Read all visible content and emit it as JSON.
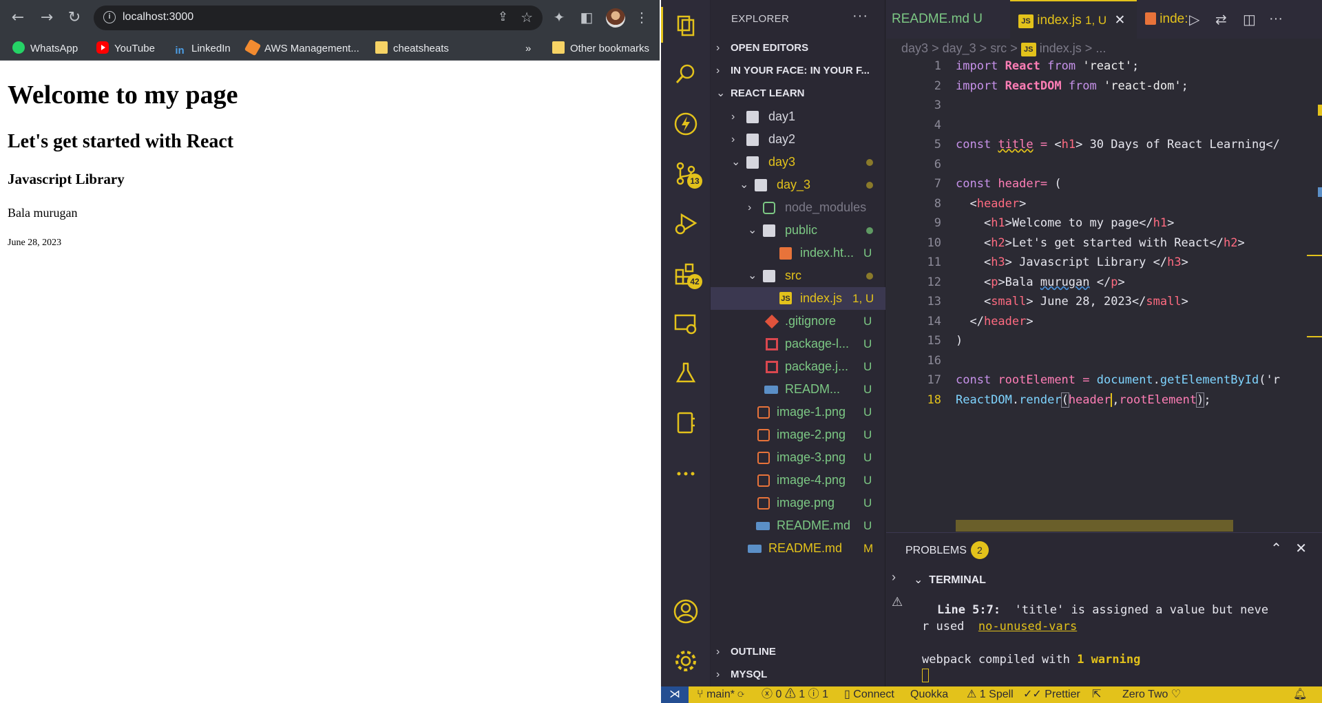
{
  "browser": {
    "url": "localhost:3000",
    "bookmarks": [
      {
        "label": "WhatsApp",
        "icon": "whatsapp-icon"
      },
      {
        "label": "YouTube",
        "icon": "youtube-icon"
      },
      {
        "label": "LinkedIn",
        "icon": "linkedin-icon"
      },
      {
        "label": "AWS Management...",
        "icon": "aws-icon"
      },
      {
        "label": "cheatsheats",
        "icon": "folder-icon"
      }
    ],
    "overflow": "»",
    "other_bookmarks": "Other bookmarks",
    "page": {
      "h1": "Welcome to my page",
      "h2": "Let's get started with React",
      "h3": "Javascript Library",
      "p": "Bala murugan",
      "small": "June 28, 2023"
    }
  },
  "vscode": {
    "explorer_title": "EXPLORER",
    "more": "···",
    "sections": {
      "open_editors": "OPEN EDITORS",
      "workspace2": "IN YOUR FACE: IN YOUR F...",
      "workspace": "REACT LEARN",
      "outline": "OUTLINE",
      "mysql": "MYSQL"
    },
    "activity_badges": {
      "source_control": "13",
      "extensions": "42"
    },
    "tree": [
      {
        "name": "day1",
        "stat": ""
      },
      {
        "name": "day2",
        "stat": ""
      },
      {
        "name": "day3",
        "stat": ""
      },
      {
        "name": "day_3",
        "stat": ""
      },
      {
        "name": "node_modules",
        "stat": ""
      },
      {
        "name": "public",
        "stat": ""
      },
      {
        "name": "index.ht...",
        "stat": "U"
      },
      {
        "name": "src",
        "stat": ""
      },
      {
        "name": "index.js",
        "stat": "1, U"
      },
      {
        "name": ".gitignore",
        "stat": "U"
      },
      {
        "name": "package-l...",
        "stat": "U"
      },
      {
        "name": "package.j...",
        "stat": "U"
      },
      {
        "name": "READM...",
        "stat": "U"
      },
      {
        "name": "image-1.png",
        "stat": "U"
      },
      {
        "name": "image-2.png",
        "stat": "U"
      },
      {
        "name": "image-3.png",
        "stat": "U"
      },
      {
        "name": "image-4.png",
        "stat": "U"
      },
      {
        "name": "image.png",
        "stat": "U"
      },
      {
        "name": "README.md",
        "stat": "U"
      },
      {
        "name": "README.md",
        "stat": "M"
      }
    ],
    "tabs": [
      {
        "label": "README.md",
        "stat": "U"
      },
      {
        "label": "index.js",
        "stat": "1, U",
        "close": "✕"
      },
      {
        "label": "inde:",
        "stat": ""
      }
    ],
    "breadcrumb": {
      "a": "day3",
      "b": "day_3",
      "c": "src",
      "file": "index.js",
      "sep": ">",
      "more": "..."
    },
    "line_numbers": [
      "1",
      "2",
      "3",
      "4",
      "5",
      "6",
      "7",
      "8",
      "9",
      "10",
      "11",
      "12",
      "13",
      "14",
      "15",
      "16",
      "17",
      "18"
    ],
    "panel": {
      "problems": "PROBLEMS",
      "problems_count": "2",
      "terminal": "TERMINAL",
      "line_ref": "Line 5:7:",
      "message": "'title' is assigned a value but neve",
      "message2": "r used",
      "rule": "no-unused-vars",
      "compiled": "webpack compiled with",
      "warning": "1 warning"
    },
    "status": {
      "branch": "main*",
      "errors": "0",
      "warnings": "1",
      "info": "1",
      "connect": "Connect",
      "quokka": "Quokka",
      "spell": "1 Spell",
      "prettier": "Prettier",
      "theme": "Zero Two"
    }
  }
}
